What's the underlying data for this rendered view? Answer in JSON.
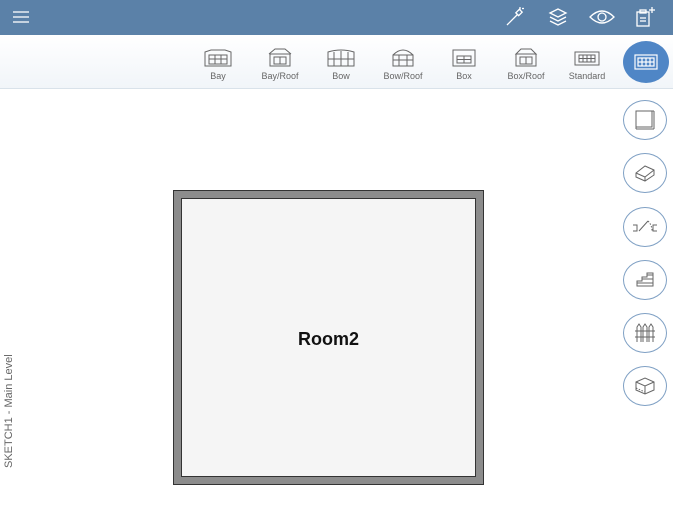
{
  "topbar": {
    "menu_icon": "hamburger-menu-icon",
    "actions": [
      "magic-wand-icon",
      "layers-icon",
      "eye-icon",
      "clipboard-add-icon"
    ]
  },
  "toolbar": {
    "tools": [
      {
        "label": "Bay",
        "icon": "bay-window-icon"
      },
      {
        "label": "Bay/Roof",
        "icon": "bay-roof-window-icon"
      },
      {
        "label": "Bow",
        "icon": "bow-window-icon"
      },
      {
        "label": "Bow/Roof",
        "icon": "bow-roof-window-icon"
      },
      {
        "label": "Box",
        "icon": "box-window-icon"
      },
      {
        "label": "Box/Roof",
        "icon": "box-roof-window-icon"
      },
      {
        "label": "Standard",
        "icon": "standard-window-icon"
      }
    ],
    "active_tool_icon": "window-icon"
  },
  "side_tools": [
    "wall-icon",
    "shape-icon",
    "door-icon",
    "stairs-icon",
    "fence-icon",
    "box-3d-icon"
  ],
  "canvas": {
    "room_label": "Room2",
    "level_label": "SKETCH1 - Main Level"
  },
  "colors": {
    "topbar": "#5b81a8",
    "accent": "#4f86c6",
    "room_wall": "#8c8c8c"
  }
}
